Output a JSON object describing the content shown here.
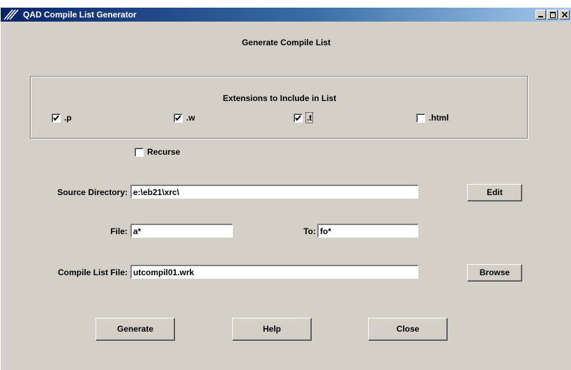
{
  "window": {
    "title": "QAD Compile List Generator"
  },
  "heading": "Generate Compile List",
  "extensions": {
    "title": "Extensions to Include in List",
    "items": [
      {
        "label": ".p",
        "checked": true
      },
      {
        "label": ".w",
        "checked": true
      },
      {
        "label": ".t",
        "checked": true
      },
      {
        "label": ".html",
        "checked": false
      }
    ]
  },
  "recurse": {
    "label": "Recurse",
    "checked": false
  },
  "source_directory": {
    "label": "Source Directory:",
    "value": "e:\\eb21\\xrc\\"
  },
  "edit_button": "Edit",
  "file": {
    "label": "File:",
    "value": "a*"
  },
  "to": {
    "label": "To:",
    "value": "fo*"
  },
  "compile_list_file": {
    "label": "Compile List File:",
    "value": "utcompil01.wrk"
  },
  "browse_button": "Browse",
  "buttons": {
    "generate": "Generate",
    "help": "Help",
    "close": "Close"
  }
}
